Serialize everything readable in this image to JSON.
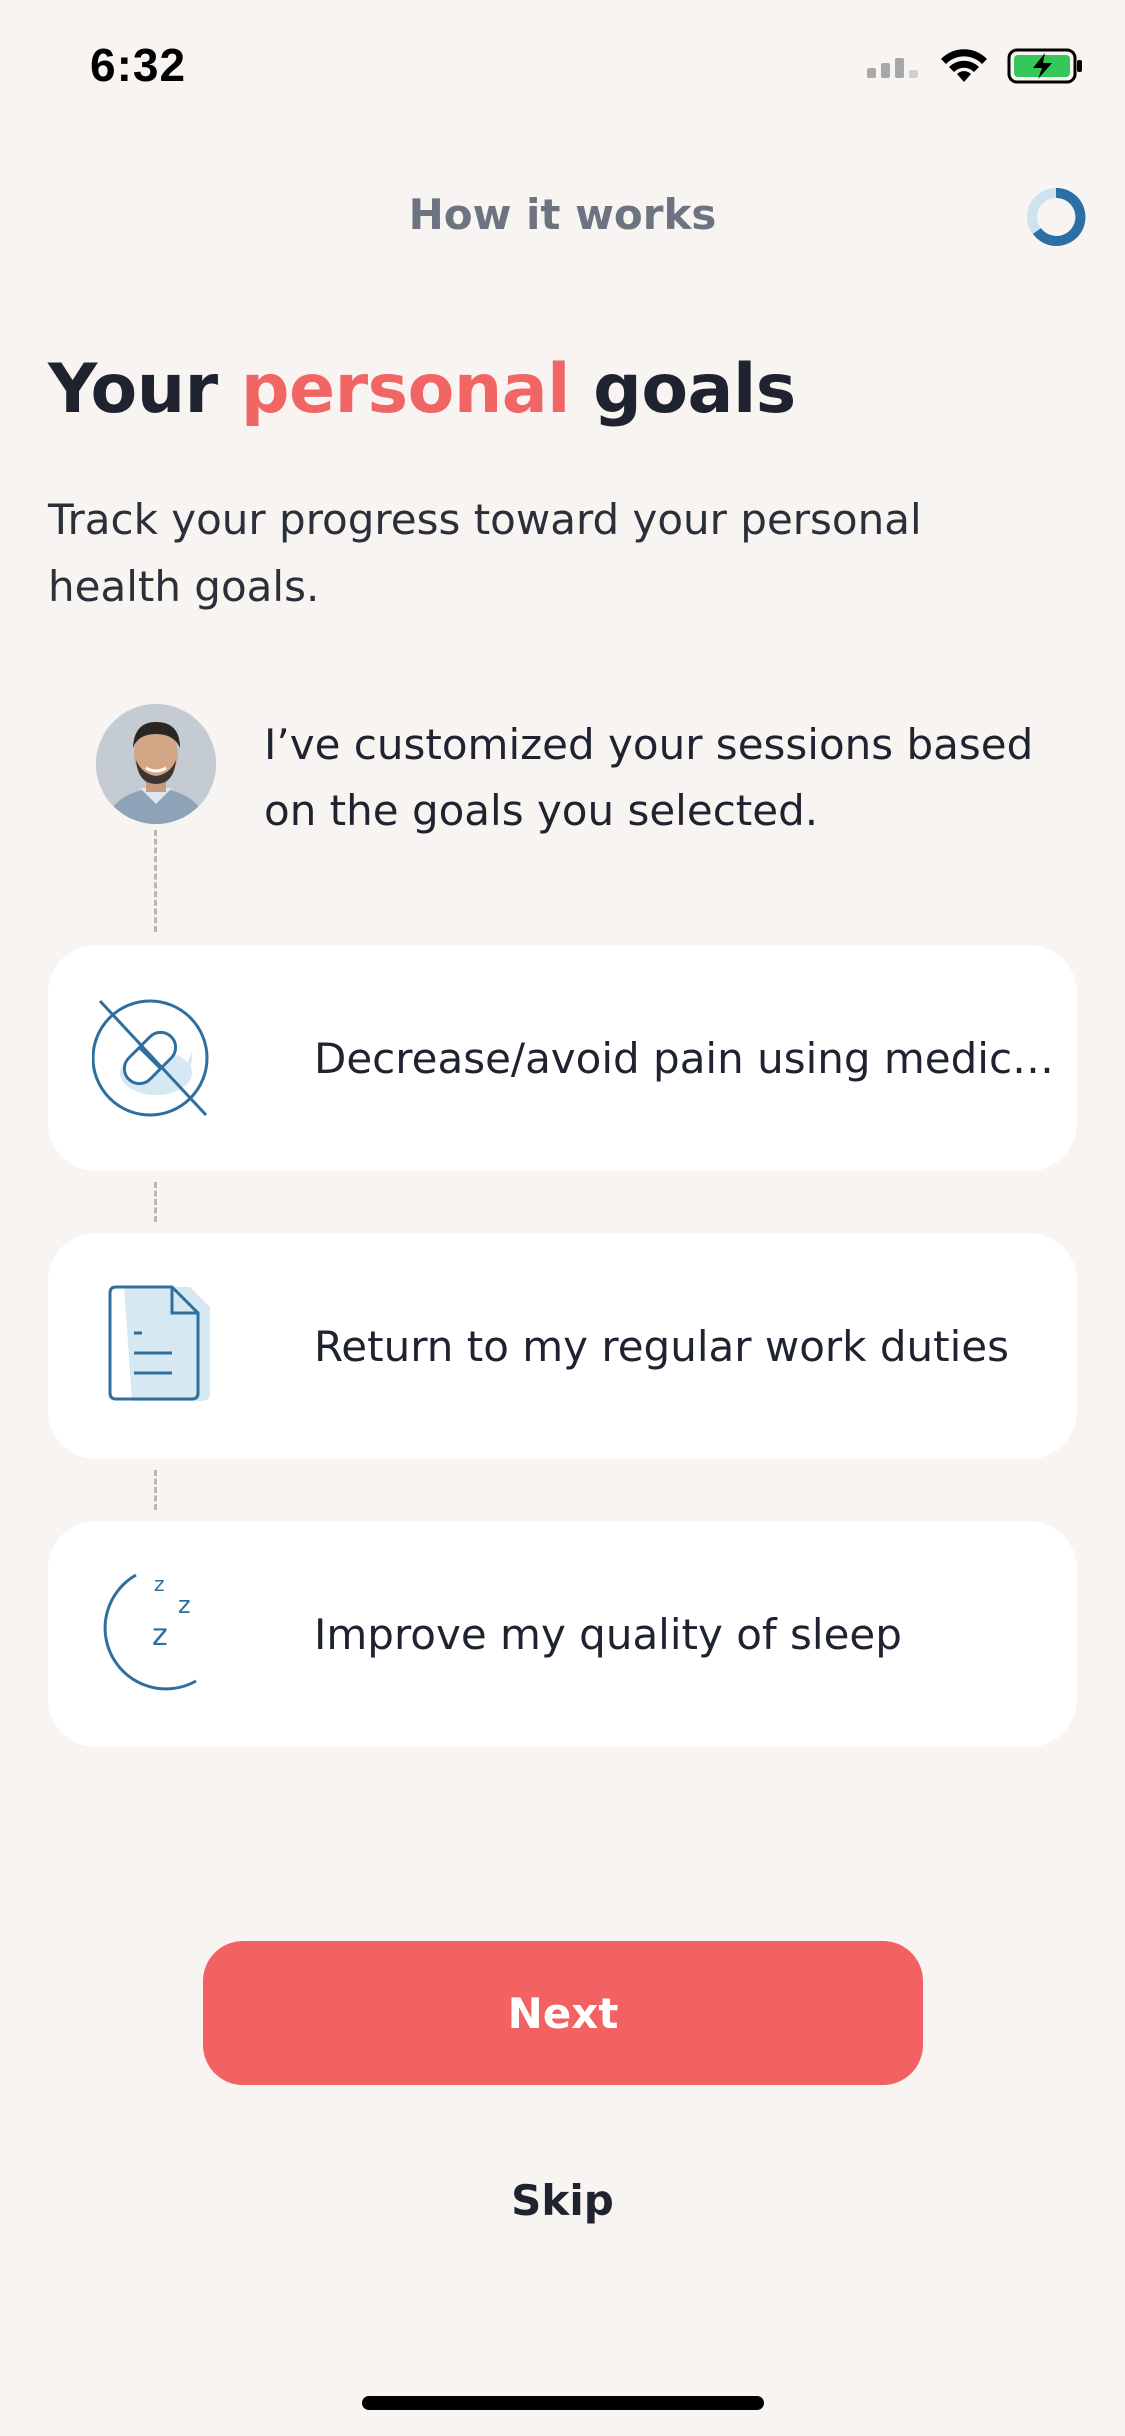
{
  "status_bar": {
    "time": "6:32",
    "icons": [
      "signal-icon",
      "wifi-icon",
      "battery-charging-icon"
    ]
  },
  "header": {
    "title": "How it works",
    "progress_icon": "progress-ring-icon"
  },
  "headline": {
    "part1": "Your ",
    "accent": "personal",
    "part2": " goals"
  },
  "subtitle": "Track your progress toward your personal health goals.",
  "coach": {
    "message": "I’ve customized your sessions based on the goals you selected."
  },
  "goals": [
    {
      "icon": "no-pill-icon",
      "label": "Decrease/avoid pain using medicat…"
    },
    {
      "icon": "document-icon",
      "label": "Return to my regular work duties"
    },
    {
      "icon": "moon-sleep-icon",
      "label": "Improve my quality of sleep"
    }
  ],
  "actions": {
    "next_label": "Next",
    "skip_label": "Skip"
  },
  "colors": {
    "accent": "#f26565",
    "button": "#f26262",
    "icon_blue": "#2f6f9e",
    "icon_fill": "#d6e8f2",
    "background": "#f7f4f1"
  }
}
